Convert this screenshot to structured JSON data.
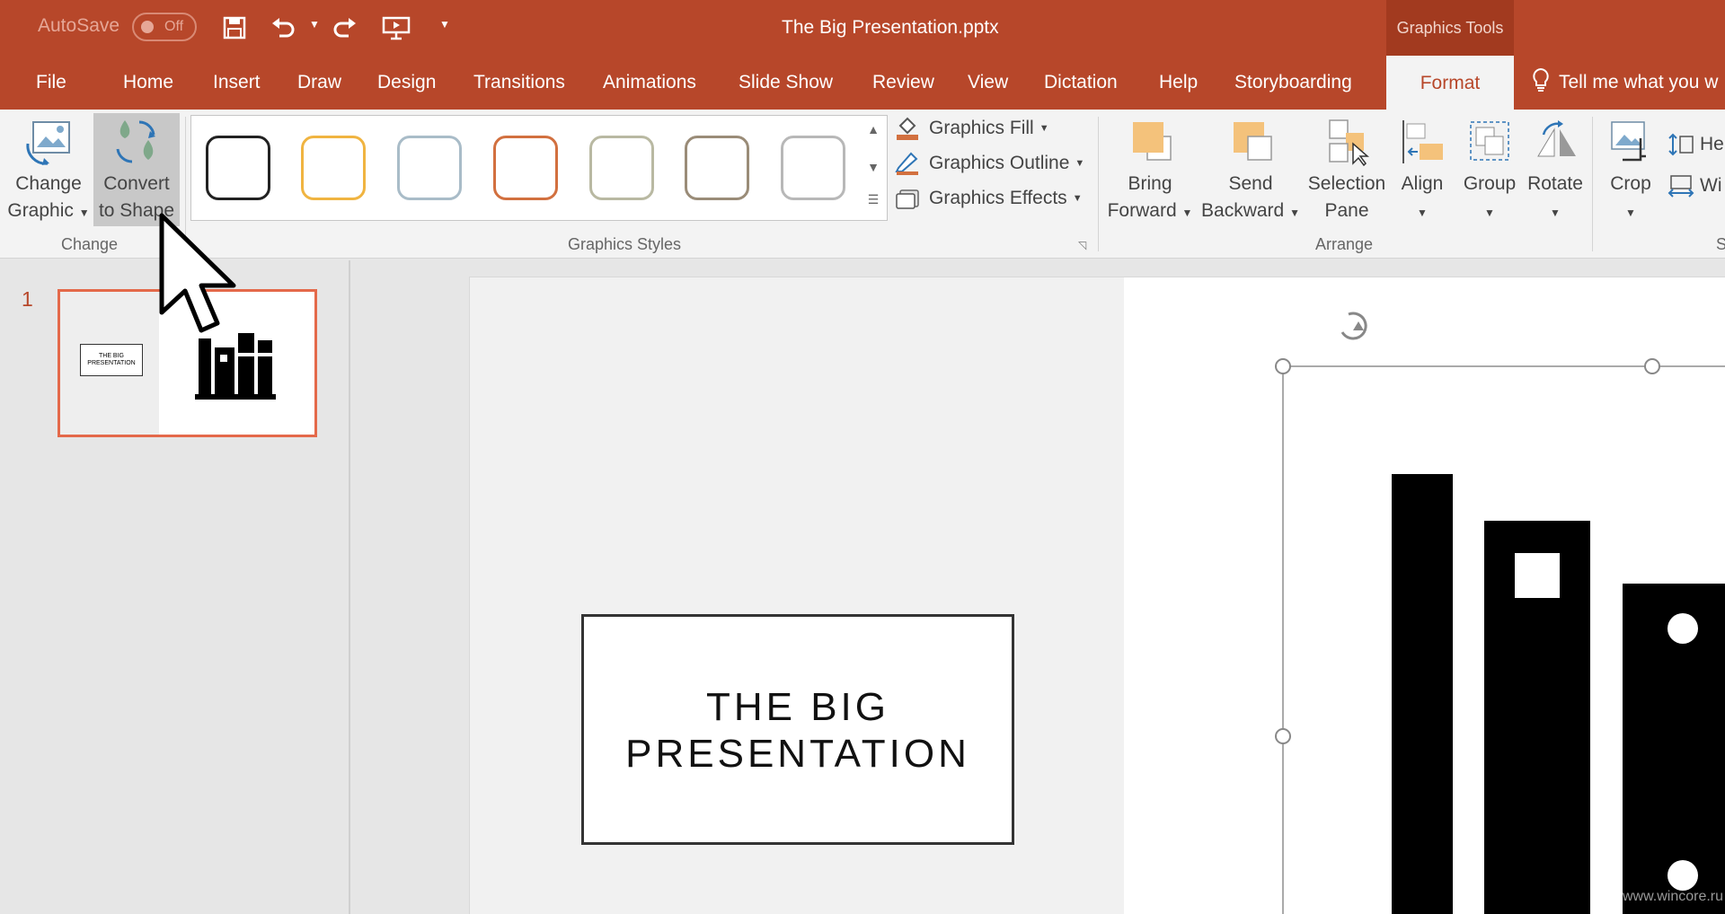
{
  "titlebar": {
    "autosave_label": "AutoSave",
    "autosave_state": "Off",
    "document_title": "The Big Presentation.pptx",
    "contextual_tab_group": "Graphics Tools"
  },
  "tabs": [
    {
      "label": "File"
    },
    {
      "label": "Home"
    },
    {
      "label": "Insert"
    },
    {
      "label": "Draw"
    },
    {
      "label": "Design"
    },
    {
      "label": "Transitions"
    },
    {
      "label": "Animations"
    },
    {
      "label": "Slide Show"
    },
    {
      "label": "Review"
    },
    {
      "label": "View"
    },
    {
      "label": "Dictation"
    },
    {
      "label": "Help"
    },
    {
      "label": "Storyboarding"
    },
    {
      "label": "Format",
      "active": true
    }
  ],
  "tellme": "Tell me what you w",
  "ribbon": {
    "change": {
      "change_graphic_line1": "Change",
      "change_graphic_line2": "Graphic",
      "convert_line1": "Convert",
      "convert_line2": "to Shape",
      "group_label": "Change"
    },
    "graphics_styles": {
      "group_label": "Graphics Styles",
      "swatch_colors": [
        "#222222",
        "#f0b441",
        "#a9bcc8",
        "#d2703f",
        "#b9b9a2",
        "#9a8c78",
        "#b8b8b8"
      ]
    },
    "format_items": {
      "fill": "Graphics Fill",
      "outline": "Graphics Outline",
      "effects": "Graphics Effects"
    },
    "arrange": {
      "group_label": "Arrange",
      "bring_line1": "Bring",
      "bring_line2": "Forward",
      "send_line1": "Send",
      "send_line2": "Backward",
      "selection_line1": "Selection",
      "selection_line2": "Pane",
      "align": "Align",
      "group": "Group",
      "rotate": "Rotate"
    },
    "size": {
      "crop": "Crop",
      "height": "He",
      "width": "Wi",
      "group_label_partial": "S"
    }
  },
  "slides_pane": {
    "slide_number": "1",
    "thumb_text": "THE BIG PRESENTATION"
  },
  "slide": {
    "title_line1": "THE BIG",
    "title_line2": "PRESENTATION"
  },
  "watermark": "www.wincore.ru",
  "colors": {
    "accent": "#b7472a",
    "ribbon_bg": "#f3f3f3",
    "selection": "#e4694a"
  }
}
